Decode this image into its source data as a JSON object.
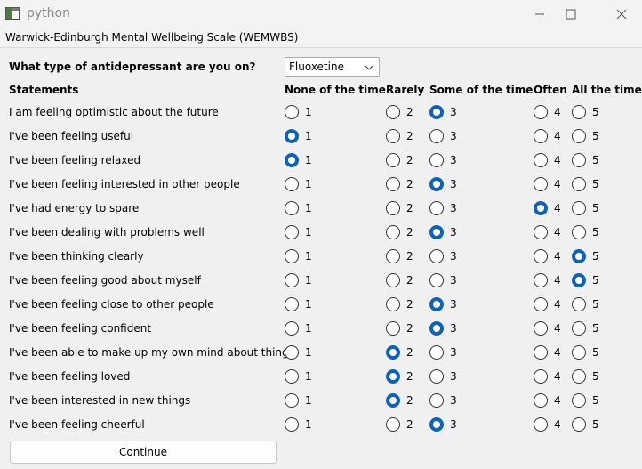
{
  "window": {
    "title": "python"
  },
  "menubar": {
    "title": "Warwick-Edinburgh Mental Wellbeing Scale (WEMWBS)"
  },
  "question": {
    "label": "What type of antidepressant are you on?",
    "selected": "Fluoxetine"
  },
  "headers": {
    "statements": "Statements",
    "options": [
      "None of the time",
      "Rarely",
      "Some of the time",
      "Often",
      "All the time"
    ]
  },
  "option_values": [
    "1",
    "2",
    "3",
    "4",
    "5"
  ],
  "rows": [
    {
      "text": "I am feeling optimistic about the future",
      "selected": 3
    },
    {
      "text": "I've been feeling useful",
      "selected": 1
    },
    {
      "text": "I've been feeling relaxed",
      "selected": 1
    },
    {
      "text": "I've been feeling interested in other people",
      "selected": 3
    },
    {
      "text": "I've had energy to spare",
      "selected": 4
    },
    {
      "text": "I've been dealing with problems well",
      "selected": 3
    },
    {
      "text": "I've been thinking clearly",
      "selected": 5
    },
    {
      "text": "I've been feeling good about myself",
      "selected": 5
    },
    {
      "text": "I've been feeling close to other people",
      "selected": 3
    },
    {
      "text": "I've been feeling confident",
      "selected": 3
    },
    {
      "text": "I've been able to make up my own mind about things",
      "selected": 2
    },
    {
      "text": "I've been feeling loved",
      "selected": 2
    },
    {
      "text": "I've been interested in new things",
      "selected": 2
    },
    {
      "text": "I've been feeling cheerful",
      "selected": 3
    }
  ],
  "continue_label": "Continue",
  "colors": {
    "accent": "#0f62b8"
  }
}
